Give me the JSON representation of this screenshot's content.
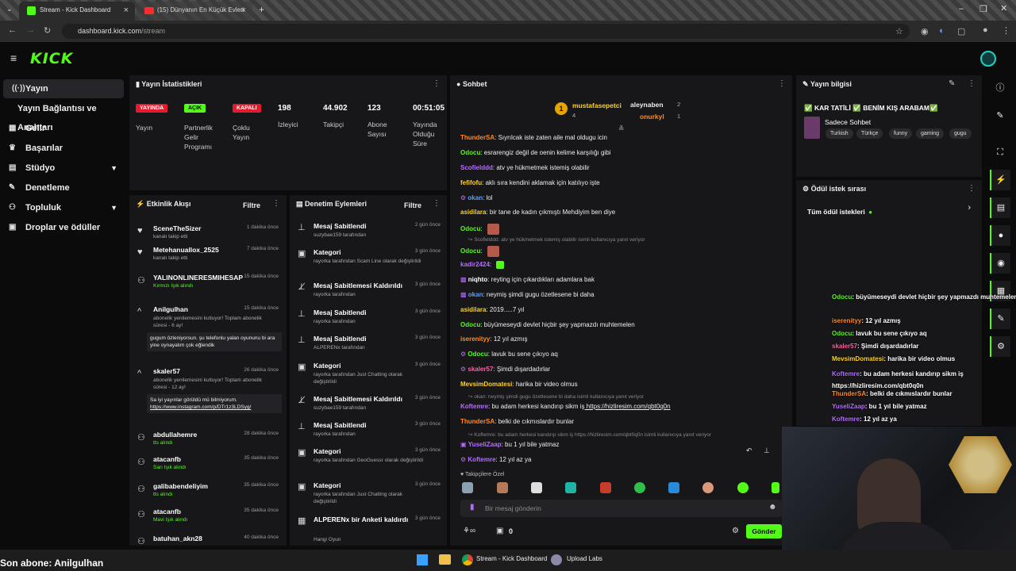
{
  "browser": {
    "tabs": [
      {
        "title": "Stream - Kick Dashboard"
      },
      {
        "title": "(15) Dünyanın En Küçük Evleri"
      }
    ],
    "url_host": "dashboard.kick.com",
    "url_path": "/stream"
  },
  "brand": {
    "logo_text": "KICK",
    "accent": "#53fc18"
  },
  "sidebar": {
    "items": [
      {
        "label": "Yayın",
        "icon": "broadcast-icon"
      },
      {
        "label": "Yayın Bağlantısı ve Anahtarı",
        "icon": ""
      },
      {
        "label": "Gelir",
        "icon": "revenue-icon"
      },
      {
        "label": "Başarılar",
        "icon": "trophy-icon"
      },
      {
        "label": "Stüdyo",
        "icon": "studio-icon"
      },
      {
        "label": "Denetleme",
        "icon": "wrench-icon"
      },
      {
        "label": "Topluluk",
        "icon": "community-icon"
      },
      {
        "label": "Droplar ve ödüller",
        "icon": "gift-icon"
      }
    ]
  },
  "stats": {
    "title": "Yayın İstatistikleri",
    "badges": [
      {
        "badge": "YAYINDA",
        "label": "Yayın",
        "color": "#e31b2c"
      },
      {
        "badge": "AÇIK",
        "label": "Partnerlik Gelir Programı",
        "color": "#53fc18"
      },
      {
        "badge": "KAPALI",
        "label": "Çoklu Yayın",
        "color": "#e31b2c"
      }
    ],
    "numbers": [
      {
        "value": "198",
        "label": "İzleyici"
      },
      {
        "value": "44.902",
        "label": "Takipçi"
      },
      {
        "value": "123",
        "label": "Abone Sayısı"
      },
      {
        "value": "00:51:05",
        "label": "Yayında Olduğu Süre"
      }
    ]
  },
  "activity": {
    "title": "Etkinlik Akışı",
    "filter": "Filtre",
    "items": [
      {
        "name": "SceneTheSizer",
        "sub": "kanalı takip etti",
        "time": "1 dakika önce"
      },
      {
        "name": "Metehanuallox_2525",
        "sub": "kanalı takip etti",
        "time": "7 dakika önce"
      },
      {
        "name": "YALINONLINERESMIHESAP",
        "sub": "Kırmızı Işık alındı",
        "time": "15 dakika önce"
      },
      {
        "name": "Anilgulhan",
        "sub": "abonelik yenilemesini kutluyor! Toplam abonelik süresi - 6 ay!",
        "msg": "gugum özleniyorsun. şu telefonlu yalan oyununu bi ara yine oynayalım çok eğlendik",
        "time": "15 dakika önce"
      },
      {
        "name": "skaler57",
        "sub": "abonelik yenilemesini kutluyor! Toplam abonelik süresi - 12 ay!",
        "msg": "Sa iyi yayınlar görüldü mü bilmiyorum.",
        "link": "https://www.instagram.com/p/DTr1z3LDSyg/",
        "time": "26 dakika önce"
      },
      {
        "name": "abdullahemre",
        "sub": "tts alındı",
        "time": "28 dakika önce"
      },
      {
        "name": "atacanfb",
        "sub": "Sarı Işık alındı",
        "time": "35 dakika önce"
      },
      {
        "name": "galibabendeliyim",
        "sub": "tts alındı",
        "time": "35 dakika önce"
      },
      {
        "name": "atacanfb",
        "sub": "Mavi Işık alındı",
        "time": "35 dakika önce"
      },
      {
        "name": "batuhan_akn28",
        "sub": "",
        "time": "40 dakika önce"
      }
    ]
  },
  "modlog": {
    "title": "Denetim Eylemleri",
    "filter": "Filtre",
    "items": [
      {
        "name": "Mesaj Sabitlendi",
        "sub": "suzybae159 tarafından",
        "time": "2 gün önce"
      },
      {
        "name": "Kategori",
        "sub": "rayorka tarafından Scam Line olarak değiştirildi",
        "time": "3 gün önce"
      },
      {
        "name": "Mesaj Sabitlemesi Kaldırıldı",
        "sub": "rayorka tarafından",
        "time": "3 gün önce"
      },
      {
        "name": "Mesaj Sabitlendi",
        "sub": "rayorka tarafından",
        "time": "3 gün önce"
      },
      {
        "name": "Mesaj Sabitlendi",
        "sub": "ALPERENx tarafından",
        "time": "3 gün önce"
      },
      {
        "name": "Kategori",
        "sub": "rayorka tarafından Just Chatting olarak değiştirildi",
        "time": "3 gün önce"
      },
      {
        "name": "Mesaj Sabitlemesi Kaldırıldı",
        "sub": "suzybae159 tarafından",
        "time": "3 gün önce"
      },
      {
        "name": "Mesaj Sabitlendi",
        "sub": "rayorka tarafından",
        "time": "3 gün önce"
      },
      {
        "name": "Kategori",
        "sub": "rayorka tarafından GeoGuessr olarak değiştirildi",
        "time": "3 gün önce"
      },
      {
        "name": "Kategori",
        "sub": "rayorka tarafından Just Chatting olarak değiştirildi",
        "time": "3 gün önce"
      },
      {
        "name": "ALPERENx bir Anketi kaldırdı",
        "sub": "Hangi Oyun",
        "time": "3 gün önce"
      }
    ]
  },
  "chat": {
    "title": "Sohbet",
    "top": [
      {
        "name": "mustafasepetci",
        "count": "4"
      },
      {
        "name": "aleynaben",
        "count": "2"
      },
      {
        "name": "onurkyl",
        "count": "1"
      }
    ],
    "messages": [
      {
        "user": "ThunderSA",
        "color": "#ff8a1f",
        "text": "Sıyrılcak iste zaten aile mal oldugu icin"
      },
      {
        "user": "Odocu",
        "color": "#53fc18",
        "text": "esrarengiz değil de oenin kelime karşılığı gibi"
      },
      {
        "user": "Scofielddd",
        "color": "#b66dff",
        "text": "atv ye hükmetmek istemiş olabilir"
      },
      {
        "user": "fefifofu",
        "color": "#ffd21f",
        "text": "aklı sıra kendini aklamak için katılıyo işte"
      },
      {
        "user": "okan",
        "color": "#5aa0ff",
        "text": "lol"
      },
      {
        "user": "asidilara",
        "color": "#ffd21f",
        "text": "bir tane de kadın çıkmıştı Mehdiyim ben diye"
      },
      {
        "user": "Odocu",
        "color": "#53fc18",
        "text": ""
      },
      {
        "user": "Odocu",
        "color": "#53fc18",
        "text": ""
      },
      {
        "user": "kadir2424",
        "color": "#b66dff",
        "text": ""
      },
      {
        "user": "niqhto",
        "color": "#ffffff",
        "text": "reyting için çıkardıkları adamlara bak"
      },
      {
        "user": "okan",
        "color": "#5aa0ff",
        "text": "neymiş şimdi gugu özetlesene bi daha"
      },
      {
        "user": "asidilara",
        "color": "#ffd21f",
        "text": "2019.....7 yıl"
      },
      {
        "user": "Odocu",
        "color": "#53fc18",
        "text": "büyümeseydi devlet hiçbir şey yapmazdı muhtemelen"
      },
      {
        "user": "iserenityy",
        "color": "#ff8a1f",
        "text": "12 yıl azmış"
      },
      {
        "user": "Odocu",
        "color": "#53fc18",
        "text": "lavuk bu sene çıkıyo aq"
      },
      {
        "user": "skaler57",
        "color": "#ff5fa2",
        "text": "Şimdi dışardadırlar"
      },
      {
        "user": "MevsimDomatesi",
        "color": "#ffd21f",
        "text": "harika bir video olmus"
      },
      {
        "user": "Koftemre",
        "color": "#b66dff",
        "text": "bu adam herkesi kandırıp sikm iş",
        "link": "https://hizliresim.com/qbt0q0n"
      },
      {
        "user": "ThunderSA",
        "color": "#ff8a1f",
        "text": "belki de cıkmıslardır bunlar"
      },
      {
        "user": "YuseliZaap",
        "color": "#b66dff",
        "text": "bu 1 yıl bile yatmaz"
      },
      {
        "user": "Koftemre",
        "color": "#b66dff",
        "text": "12 yıl az ya"
      }
    ],
    "replies": [
      "Scofielddd: atv ye hükmetmek istemiş olabilir isimli kullanıcıya yanıt veriyor",
      "okan: neymiş şimdi gugu özetlesene bi daha isimli kullanıcıya yanıt veriyor",
      "Koftemre: bu adam herkesi kandırıp sikm iş https://hizliresim.com/qbt0q0n isimli kullanıcıya yanıt veriyor"
    ],
    "emote_section": "Takipçilere Özel",
    "input_placeholder": "Bir mesaj gönderin",
    "points": "0",
    "send_label": "Gönder"
  },
  "streaminfo": {
    "title": "Yayın bilgisi",
    "stream_title": "KAR TATİLİ ✅ BENİM KIŞ ARABAM✅",
    "category": "Sadece Sohbet",
    "tags": [
      "Turkish",
      "Türkçe",
      "funny",
      "gaming",
      "gugu"
    ]
  },
  "rewards": {
    "title": "Ödül istek sırası",
    "all_label": "Tüm ödül istekleri"
  },
  "overlay_chat": [
    {
      "user": "Odocu",
      "color": "#53fc18",
      "text": "büyümeseydi devlet hiçbir şey yapmazdı muhtemelen"
    },
    {
      "user": "iserenityy",
      "color": "#ff8a1f",
      "text": "12 yıl azmış"
    },
    {
      "user": "Odocu",
      "color": "#53fc18",
      "text": "lavuk bu sene çıkıyo aq"
    },
    {
      "user": "skaler57",
      "color": "#ff5fa2",
      "text": "Şimdi dışardadırlar"
    },
    {
      "user": "MevsimDomatesi",
      "color": "#ffd21f",
      "text": "harika bir video olmus"
    },
    {
      "user": "Koftemre",
      "color": "#b66dff",
      "text": "bu adam herkesi kandırıp sikm iş https://hizliresim.com/qbt0q0n"
    },
    {
      "user": "ThunderSA",
      "color": "#ff8a1f",
      "text": "belki de cıkmıslardır bunlar"
    },
    {
      "user": "YuseliZaap",
      "color": "#b66dff",
      "text": "bu 1 yıl bile yatmaz"
    },
    {
      "user": "Koftemre",
      "color": "#b66dff",
      "text": "12 yıl az ya"
    }
  ],
  "overlay": {
    "last_sub": "Son abone: Anilgulhan"
  },
  "taskbar": {
    "items": [
      {
        "label": "Stream - Kick Dashboard"
      },
      {
        "label": "Upload Labs"
      }
    ]
  }
}
